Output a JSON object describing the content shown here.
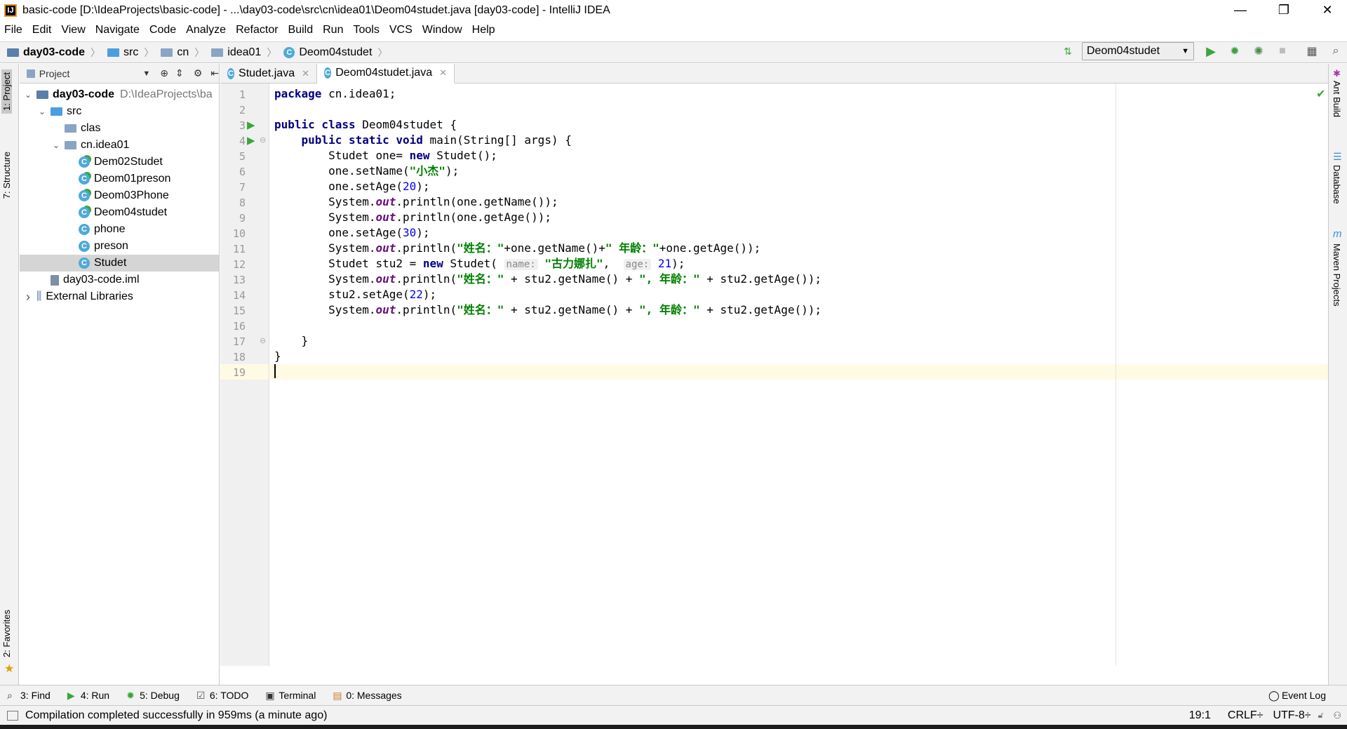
{
  "window": {
    "title": "basic-code [D:\\IdeaProjects\\basic-code] - ...\\day03-code\\src\\cn\\idea01\\Deom04studet.java [day03-code] - IntelliJ IDEA",
    "logo": "IJ"
  },
  "menu": [
    "File",
    "Edit",
    "View",
    "Navigate",
    "Code",
    "Analyze",
    "Refactor",
    "Build",
    "Run",
    "Tools",
    "VCS",
    "Window",
    "Help"
  ],
  "breadcrumbs": [
    "day03-code",
    "src",
    "cn",
    "idea01",
    "Deom04studet"
  ],
  "run_config": "Deom04studet",
  "left_tabs": [
    "1: Project",
    "7: Structure",
    "2: Favorites"
  ],
  "right_tabs": [
    "Ant Build",
    "Database",
    "Maven Projects"
  ],
  "project_panel": {
    "title": "Project",
    "tree": [
      {
        "label": "day03-code",
        "suffix": "D:\\IdeaProjects\\ba",
        "arrow": "v",
        "depth": 0,
        "type": "module"
      },
      {
        "label": "src",
        "arrow": "v",
        "depth": 1,
        "type": "src"
      },
      {
        "label": "clas",
        "arrow": "",
        "depth": 2,
        "type": "folder"
      },
      {
        "label": "cn.idea01",
        "arrow": "v",
        "depth": 2,
        "type": "package"
      },
      {
        "label": "Dem02Studet",
        "arrow": "",
        "depth": 3,
        "type": "class-run"
      },
      {
        "label": "Deom01preson",
        "arrow": "",
        "depth": 3,
        "type": "class-run"
      },
      {
        "label": "Deom03Phone",
        "arrow": "",
        "depth": 3,
        "type": "class-run"
      },
      {
        "label": "Deom04studet",
        "arrow": "",
        "depth": 3,
        "type": "class-run"
      },
      {
        "label": "phone",
        "arrow": "",
        "depth": 3,
        "type": "class"
      },
      {
        "label": "preson",
        "arrow": "",
        "depth": 3,
        "type": "class"
      },
      {
        "label": "Studet",
        "arrow": "",
        "depth": 3,
        "type": "class",
        "selected": true
      },
      {
        "label": "day03-code.iml",
        "arrow": "",
        "depth": 1,
        "type": "iml"
      },
      {
        "label": "External Libraries",
        "arrow": ">",
        "depth": 0,
        "type": "libs"
      }
    ]
  },
  "editor_tabs": [
    {
      "label": "Studet.java",
      "active": false
    },
    {
      "label": "Deom04studet.java",
      "active": true
    }
  ],
  "code_lines": [
    {
      "n": "1",
      "html": "<span class=\"kw\">package</span> cn.idea01;"
    },
    {
      "n": "2",
      "html": ""
    },
    {
      "n": "3",
      "html": "<span class=\"kw\">public class</span> Deom04studet {"
    },
    {
      "n": "4",
      "html": "    <span class=\"kw\">public static void</span> main(String[] args) {"
    },
    {
      "n": "5",
      "html": "        Studet one= <span class=\"kw\">new</span> Studet();"
    },
    {
      "n": "6",
      "html": "        one.setName(<span class=\"str\">\"小杰\"</span>);"
    },
    {
      "n": "7",
      "html": "        one.setAge(<span class=\"num\">20</span>);"
    },
    {
      "n": "8",
      "html": "        System.<span class=\"fld\">out</span>.println(one.getName());"
    },
    {
      "n": "9",
      "html": "        System.<span class=\"fld\">out</span>.println(one.getAge());"
    },
    {
      "n": "10",
      "html": "        one.setAge(<span class=\"num\">30</span>);"
    },
    {
      "n": "11",
      "html": "        System.<span class=\"fld\">out</span>.println(<span class=\"str\">\"姓名：\"</span>+one.getName()+<span class=\"str\">\" 年龄：\"</span>+one.getAge());"
    },
    {
      "n": "12",
      "html": "        Studet stu2 = <span class=\"kw\">new</span> Studet( <span class=\"hint\">name:</span> <span class=\"str\">\"古力娜扎\"</span>,  <span class=\"hint\">age:</span> <span class=\"num\">21</span>);"
    },
    {
      "n": "13",
      "html": "        System.<span class=\"fld\">out</span>.println(<span class=\"str\">\"姓名：\"</span> + stu2.getName() + <span class=\"str\">\", 年龄：\"</span> + stu2.getAge());"
    },
    {
      "n": "14",
      "html": "        stu2.setAge(<span class=\"num\">22</span>);"
    },
    {
      "n": "15",
      "html": "        System.<span class=\"fld\">out</span>.println(<span class=\"str\">\"姓名：\"</span> + stu2.getName() + <span class=\"str\">\", 年龄：\"</span> + stu2.getAge());"
    },
    {
      "n": "16",
      "html": ""
    },
    {
      "n": "17",
      "html": "    }"
    },
    {
      "n": "18",
      "html": "}"
    },
    {
      "n": "19",
      "html": ""
    }
  ],
  "bottom_tools": [
    {
      "label": "3: Find",
      "icon": "search-icon"
    },
    {
      "label": "4: Run",
      "icon": "run-icon"
    },
    {
      "label": "5: Debug",
      "icon": "debug-icon"
    },
    {
      "label": "6: TODO",
      "icon": "todo-icon"
    },
    {
      "label": "Terminal",
      "icon": "terminal-icon"
    },
    {
      "label": "0: Messages",
      "icon": "messages-icon"
    }
  ],
  "event_log": "Event Log",
  "status": {
    "message": "Compilation completed successfully in 959ms (a minute ago)",
    "position": "19:1",
    "line_sep": "CRLF÷",
    "encoding": "UTF-8÷"
  },
  "colors": {
    "keyword": "#000080",
    "string": "#008000",
    "number": "#0000ff",
    "field": "#660e7a",
    "accent": "#4eaad8",
    "run": "#3ba53b"
  }
}
